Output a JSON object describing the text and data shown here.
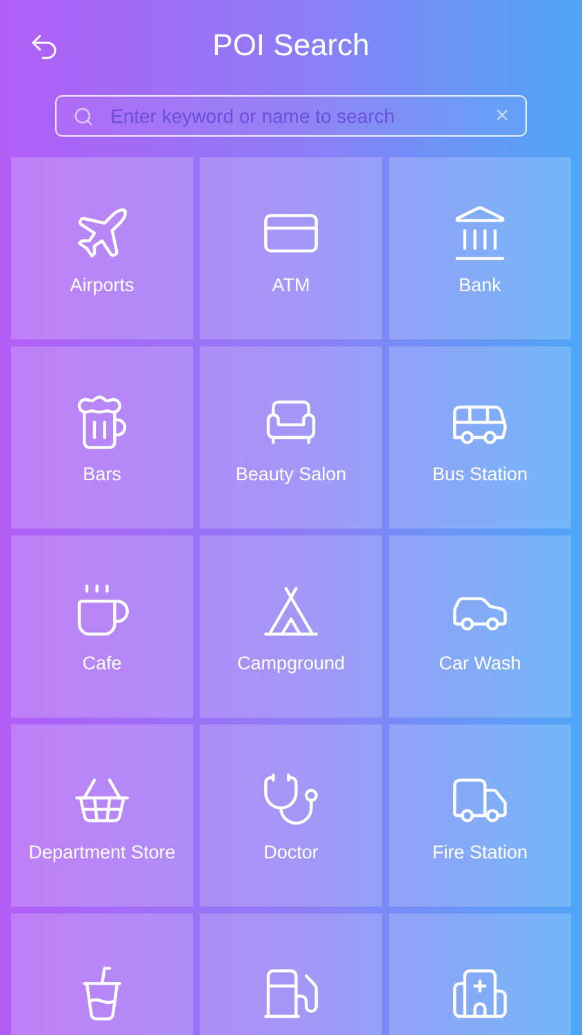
{
  "header": {
    "title": "POI Search"
  },
  "search": {
    "placeholder": "Enter keyword or name to search",
    "clear": "×"
  },
  "categories": [
    {
      "kind": "labeled",
      "label": "Airports"
    },
    {
      "kind": "labeled",
      "label": "ATM"
    },
    {
      "kind": "labeled",
      "label": "Bank"
    },
    {
      "kind": "labeled",
      "label": "Bars"
    },
    {
      "kind": "labeled",
      "label": "Beauty Salon"
    },
    {
      "kind": "labeled",
      "label": "Bus Station"
    },
    {
      "kind": "labeled",
      "label": "Cafe"
    },
    {
      "kind": "labeled",
      "label": "Campground"
    },
    {
      "kind": "labeled",
      "label": "Car Wash"
    },
    {
      "kind": "labeled",
      "label": "Department Store"
    },
    {
      "kind": "labeled",
      "label": "Doctor"
    },
    {
      "kind": "labeled",
      "label": "Fire Station"
    },
    {
      "kind": "icon_only"
    },
    {
      "kind": "icon_only"
    },
    {
      "kind": "icon_only"
    }
  ]
}
